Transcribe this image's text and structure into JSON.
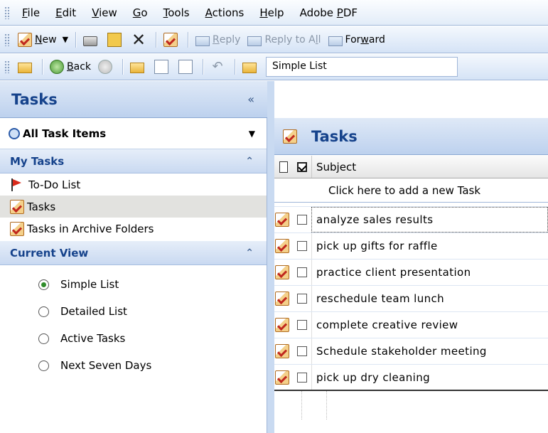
{
  "menubar": {
    "items": [
      {
        "key": "F",
        "rest": "ile"
      },
      {
        "key": "E",
        "rest": "dit"
      },
      {
        "key": "V",
        "rest": "iew"
      },
      {
        "key": "G",
        "rest": "o"
      },
      {
        "key": "T",
        "rest": "ools"
      },
      {
        "key": "A",
        "rest": "ctions"
      },
      {
        "key": "H",
        "rest": "elp"
      }
    ],
    "adobe_prefix": "Adobe ",
    "adobe_key": "P",
    "adobe_rest": "DF"
  },
  "toolbar1": {
    "new_key": "N",
    "new_rest": "ew",
    "reply_key": "R",
    "reply_rest": "eply",
    "reply_all_prefix": "Reply to A",
    "reply_all_key": "l",
    "reply_all_rest": "l",
    "forward_prefix": "For",
    "forward_key": "w",
    "forward_rest": "ard"
  },
  "toolbar2": {
    "back_key": "B",
    "back_rest": "ack",
    "view_field": "Simple List"
  },
  "nav": {
    "title": "Tasks",
    "collapse_glyph": "«",
    "combo_label": "All Task Items",
    "my_tasks": {
      "title": "My Tasks",
      "items": [
        "To-Do List",
        "Tasks",
        "Tasks in Archive Folders"
      ],
      "selected": "Tasks"
    },
    "current_view": {
      "title": "Current View",
      "options": [
        "Simple List",
        "Detailed List",
        "Active Tasks",
        "Next Seven Days"
      ],
      "selected": "Simple List"
    }
  },
  "main": {
    "title": "Tasks",
    "column_subject": "Subject",
    "add_new_hint": "Click here to add a new Task",
    "tasks": [
      "analyze sales results",
      "pick up gifts for raffle",
      "practice client presentation",
      "reschedule team lunch",
      "complete creative review",
      "Schedule stakeholder meeting",
      "pick up dry cleaning"
    ]
  },
  "colors": {
    "header_text": "#15428b",
    "toolbar_top": "#f4f8fd",
    "toolbar_bottom": "#d5e3f6"
  }
}
